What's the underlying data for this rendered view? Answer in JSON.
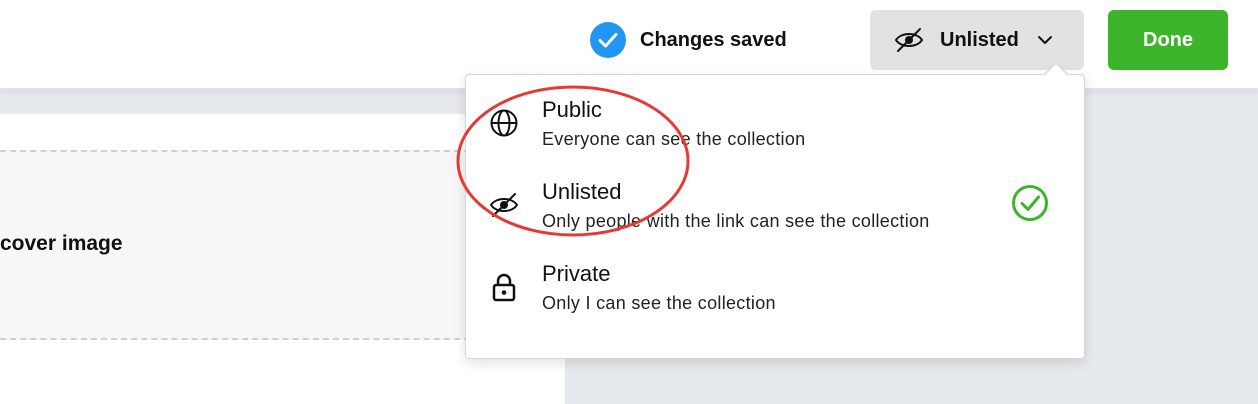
{
  "header": {
    "save_status": "Changes saved",
    "visibility_button_label": "Unlisted",
    "done_label": "Done"
  },
  "cover": {
    "label": "cover image"
  },
  "visibility_menu": {
    "options": [
      {
        "title": "Public",
        "description": "Everyone can see the collection",
        "icon": "globe-icon",
        "selected": false
      },
      {
        "title": "Unlisted",
        "description": "Only people with the link can see the collection",
        "icon": "eye-slash-icon",
        "selected": true
      },
      {
        "title": "Private",
        "description": "Only I can see the collection",
        "icon": "lock-icon",
        "selected": false
      }
    ]
  },
  "colors": {
    "saved_check": "#2196f3",
    "done_button": "#3db52a",
    "selected_check": "#3db52a",
    "annotation": "#e53935"
  }
}
